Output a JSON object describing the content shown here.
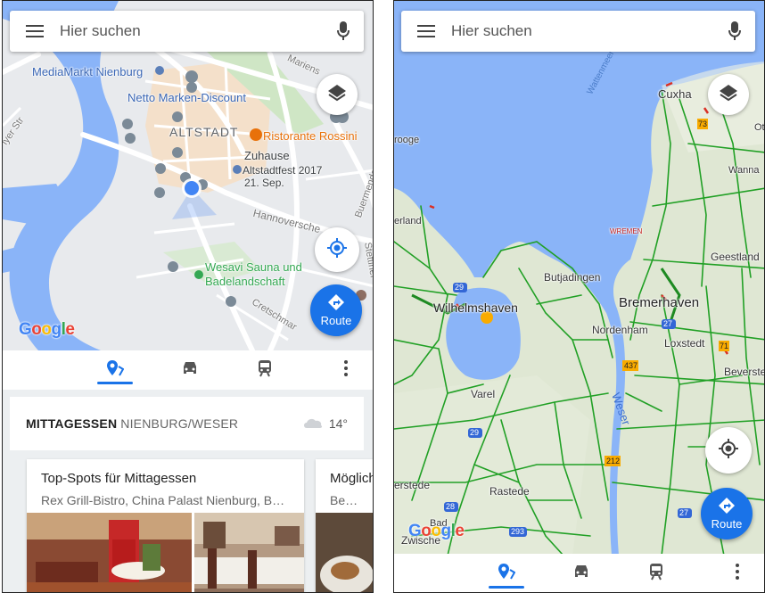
{
  "left": {
    "search": {
      "placeholder": "Hier suchen"
    },
    "map_labels": {
      "mediamarkt": "MediaMarkt Nienburg",
      "netto": "Netto Marken-Discount",
      "altstadt": "ALTSTADT",
      "rossini": "Ristorante Rossini",
      "zuhause": "Zuhause",
      "altstadtfest": "Altstadtfest 2017",
      "altstadtfest_date": "21. Sep.",
      "hannoversche": "Hannoversche",
      "wesavi_1": "Wesavi Sauna und",
      "wesavi_2": "Badelandschaft",
      "cretschmar": "Cretschmar",
      "mariens": "Mariens",
      "buermende": "Buermende",
      "stettiner": "Stettiner",
      "lyer_str": "lyer Str"
    },
    "route_label": "Route",
    "google": [
      "G",
      "o",
      "o",
      "g",
      "l",
      "e"
    ],
    "tabs": [
      "explore",
      "driving",
      "transit"
    ],
    "mittagessen": {
      "title": "MITTAGESSEN",
      "location": "NIENBURG/WESER",
      "temperature": "14°"
    },
    "cards": [
      {
        "title": "Top-Spots für Mittagessen",
        "subtitle": "Rex Grill-Bistro, China Palast Nienburg, Ber..."
      },
      {
        "title": "Möglich",
        "subtitle": "Bennies"
      }
    ]
  },
  "right": {
    "search": {
      "placeholder": "Hier suchen"
    },
    "map_labels": {
      "cuxhaven": "Cuxha",
      "wilhelmshaven": "Wilhelmshaven",
      "bremerhaven": "Bremerhaven",
      "butjadingen": "Butjadingen",
      "nordenham": "Nordenham",
      "loxstedt": "Loxstedt",
      "beverstedt": "Beverste",
      "varel": "Varel",
      "rastede": "Rastede",
      "geestland": "Geestland",
      "wanna": "Wanna",
      "weser": "Weser",
      "jerland": "erland",
      "rooge": "rooge",
      "terstede": "erstede",
      "zwische": "Zwische",
      "bad": "Bad",
      "wurmen": "WREMEN",
      "wattenmeer": "Wattenmeer",
      "ot": "Ot",
      "road_29a": "29",
      "road_29b": "29",
      "road_27a": "27",
      "road_27b": "27",
      "road_28": "28",
      "road_293": "293",
      "road_437": "437",
      "road_212": "212",
      "road_71": "71",
      "road_73": "73"
    },
    "route_label": "Route",
    "google": [
      "G",
      "o",
      "o",
      "g",
      "l",
      "e"
    ],
    "tabs": [
      "explore",
      "driving",
      "transit"
    ]
  },
  "colors": {
    "accent": "#1a73e8",
    "water": "#8ab4f8",
    "land_left": "#e8eaed",
    "land_right": "#dfe7d3",
    "traffic": "#21a025",
    "poi_orange": "#e8710a",
    "poi_green": "#34a853"
  }
}
